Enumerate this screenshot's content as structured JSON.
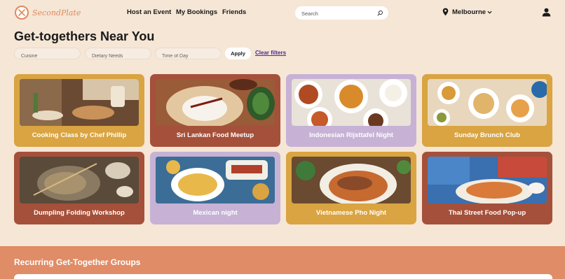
{
  "brand": {
    "name": "SecondPlate"
  },
  "nav": {
    "host": "Host an Event",
    "bookings": "My Bookings",
    "friends": "Friends"
  },
  "search": {
    "placeholder": "Search"
  },
  "location": {
    "city": "Melbourne"
  },
  "page": {
    "title": "Get-togethers Near You"
  },
  "filters": {
    "cuisine_placeholder": "Cuisine",
    "dietary_placeholder": "Dietary Needs",
    "time_placeholder": "Time of Day",
    "apply_label": "Apply",
    "clear_label": "Clear filters"
  },
  "events": [
    {
      "title": "Cooking Class by Chef Phillip",
      "color": "#d9a441"
    },
    {
      "title": "Sri Lankan Food Meetup",
      "color": "#a5503a"
    },
    {
      "title": "Indonesian Rijsttafel Night",
      "color": "#c7b2d6"
    },
    {
      "title": "Sunday Brunch Club",
      "color": "#d9a441"
    },
    {
      "title": "Dumpling Folding Workshop",
      "color": "#a5503a"
    },
    {
      "title": "Mexican night",
      "color": "#c7b2d6"
    },
    {
      "title": "Vietnamese Pho Night",
      "color": "#d9a441"
    },
    {
      "title": "Thai Street Food Pop-up",
      "color": "#a5503a"
    }
  ],
  "recurring": {
    "title": "Recurring Get-Together Groups"
  },
  "colors": {
    "background": "#f5e6d6",
    "accent_orange": "#e08c66",
    "link_purple": "#4a2b8f"
  }
}
